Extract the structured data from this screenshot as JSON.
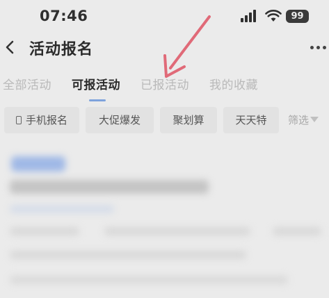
{
  "status_bar": {
    "time": "07:46",
    "battery": "99"
  },
  "header": {
    "title": "活动报名",
    "back_glyph": "‹"
  },
  "tabs": [
    {
      "label": "全部活动",
      "active": false
    },
    {
      "label": "可报活动",
      "active": true
    },
    {
      "label": "已报活动",
      "active": false
    },
    {
      "label": "我的收藏",
      "active": false
    }
  ],
  "filters": {
    "chips": [
      "手机报名",
      "大促爆发",
      "聚划算",
      "天天特"
    ],
    "filter_label": "筛选"
  },
  "colors": {
    "background": "#ebebeb",
    "accent_indicator": "#7ea3dc",
    "annotation_arrow": "#e06a78",
    "blurred_tag": "#9fb8e6"
  },
  "icons": [
    "signal-icon",
    "wifi-icon",
    "battery-icon",
    "back-icon",
    "more-icon",
    "phone-icon",
    "caret-down-icon",
    "arrow-annotation"
  ]
}
